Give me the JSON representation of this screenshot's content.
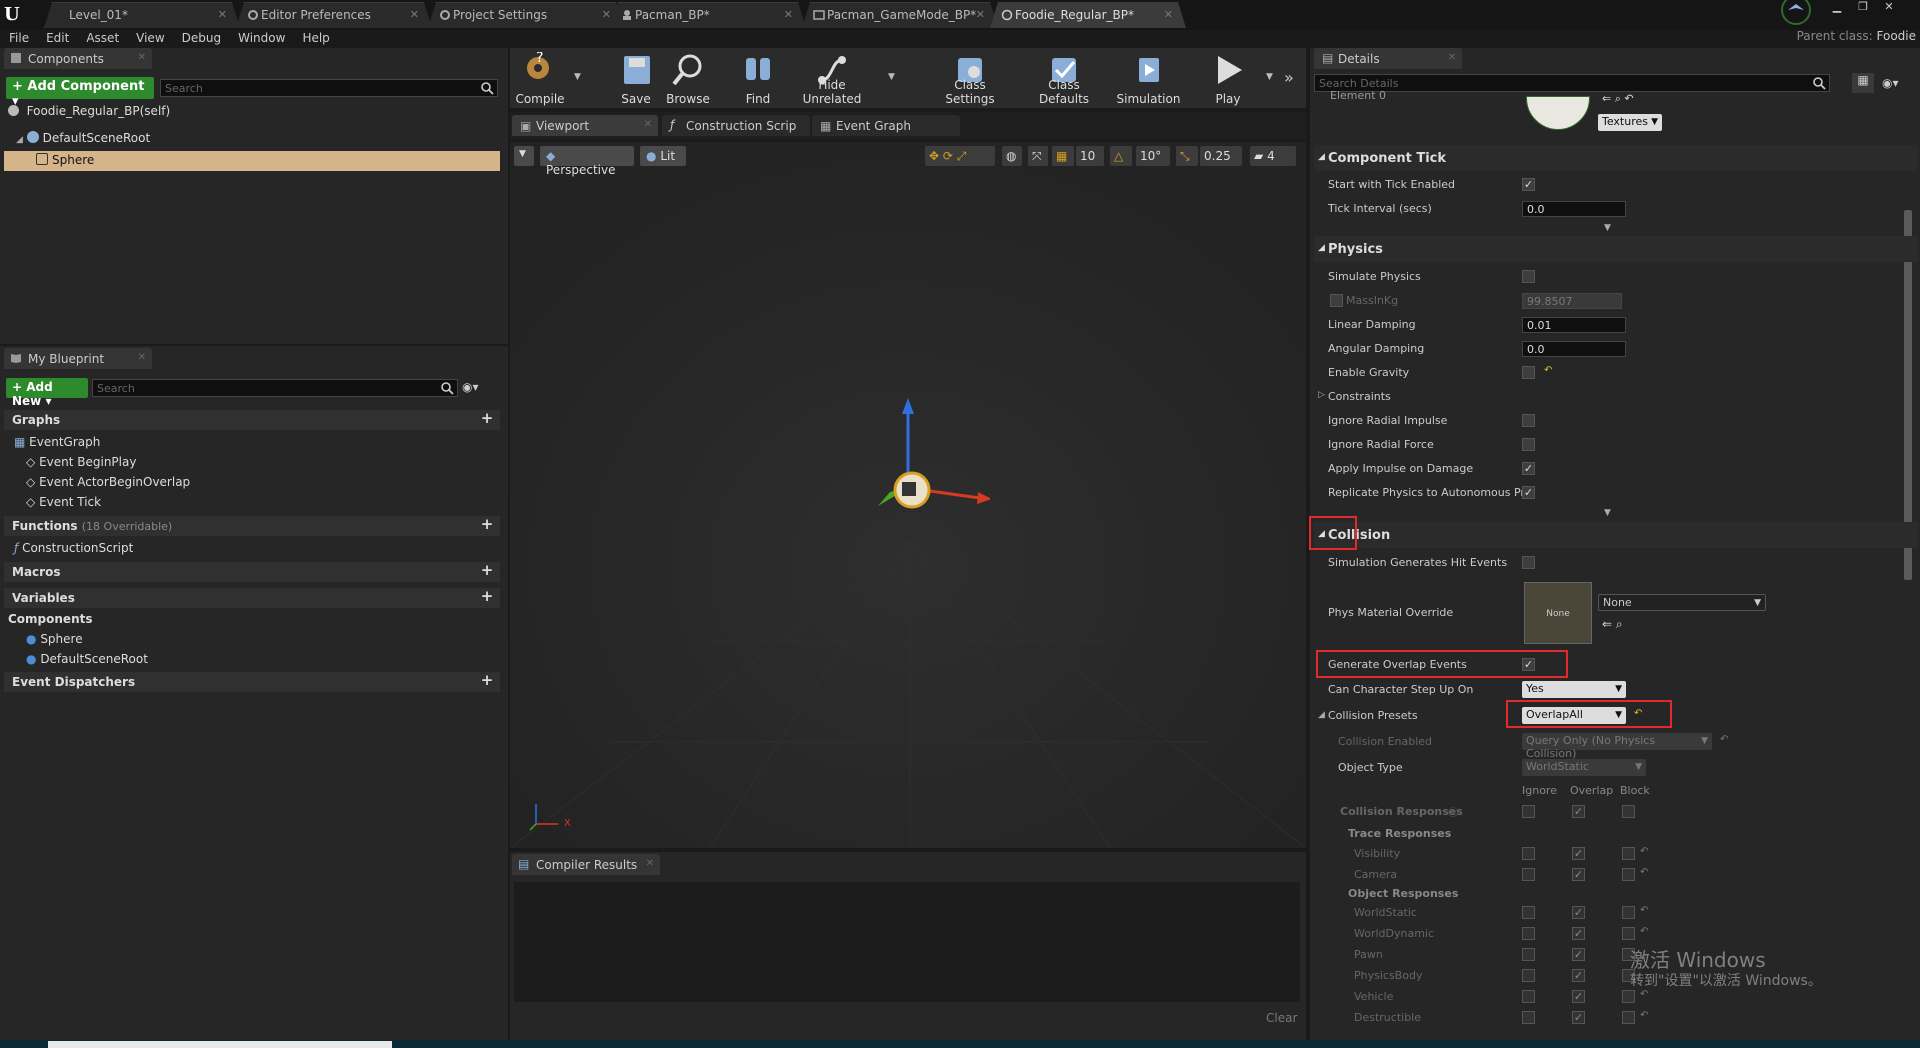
{
  "tabs": [
    {
      "label": "Level_01*",
      "active": false,
      "icon": "level-icon"
    },
    {
      "label": "Editor Preferences",
      "active": false,
      "icon": "gear-icon"
    },
    {
      "label": "Project Settings",
      "active": false,
      "icon": "gear-icon"
    },
    {
      "label": "Pacman_BP*",
      "active": false,
      "icon": "blueprint-icon"
    },
    {
      "label": "Pacman_GameMode_BP*",
      "active": false,
      "icon": "blueprint-icon"
    },
    {
      "label": "Foodie_Regular_BP*",
      "active": true,
      "icon": "blueprint-icon"
    }
  ],
  "parent_class": {
    "label": "Parent class:",
    "value": "Foodie"
  },
  "menu": [
    "File",
    "Edit",
    "Asset",
    "View",
    "Debug",
    "Window",
    "Help"
  ],
  "components_panel": {
    "tab": "Components",
    "add_component": "+ Add Component ▾",
    "search_placeholder": "Search",
    "self_item": "Foodie_Regular_BP(self)",
    "root": "DefaultSceneRoot",
    "selected": "Sphere"
  },
  "my_blueprint": {
    "tab": "My Blueprint",
    "add_new": "+ Add New ▾",
    "search_placeholder": "Search",
    "graphs_header": "Graphs",
    "event_graph": "EventGraph",
    "events": [
      "Event BeginPlay",
      "Event ActorBeginOverlap",
      "Event Tick"
    ],
    "functions_header": "Functions",
    "functions_count": "(18 Overridable)",
    "construction_script": "ConstructionScript",
    "macros_header": "Macros",
    "variables_header": "Variables",
    "components_header": "Components",
    "component_vars": [
      "Sphere",
      "DefaultSceneRoot"
    ],
    "dispatchers_header": "Event Dispatchers"
  },
  "toolbar": {
    "compile": "Compile",
    "save": "Save",
    "browse": "Browse",
    "find": "Find",
    "hide_unrelated": "Hide Unrelated",
    "class_settings": "Class Settings",
    "class_defaults": "Class Defaults",
    "simulation": "Simulation",
    "play": "Play"
  },
  "editor_tabs": [
    "Viewport",
    "Construction Scrip",
    "Event Graph"
  ],
  "viewport": {
    "perspective": "Perspective",
    "lit": "Lit",
    "grid_snap": "10",
    "rot_snap": "10°",
    "scale_snap": "0.25",
    "camera_speed": "4",
    "axis_x": "X"
  },
  "compiler": {
    "tab": "Compiler Results",
    "clear": "Clear"
  },
  "details": {
    "tab": "Details",
    "search_placeholder": "Search Details",
    "element_label": "Element 0",
    "textures_dropdown": "Textures",
    "component_tick": {
      "header": "Component Tick",
      "start_with_tick": "Start with Tick Enabled",
      "tick_interval_label": "Tick Interval (secs)",
      "tick_interval_value": "0.0"
    },
    "physics": {
      "header": "Physics",
      "simulate": "Simulate Physics",
      "mass_label": "MassInKg",
      "mass_value": "99.8507",
      "linear_damping_label": "Linear Damping",
      "linear_damping_value": "0.01",
      "angular_damping_label": "Angular Damping",
      "angular_damping_value": "0.0",
      "enable_gravity": "Enable Gravity",
      "constraints": "Constraints",
      "ignore_radial_impulse": "Ignore Radial Impulse",
      "ignore_radial_force": "Ignore Radial Force",
      "apply_impulse": "Apply Impulse on Damage",
      "replicate": "Replicate Physics to Autonomous Pro"
    },
    "collision": {
      "header": "Collision",
      "sim_hit_events": "Simulation Generates Hit Events",
      "phys_material": "Phys Material Override",
      "phys_material_thumb": "None",
      "phys_material_value": "None",
      "generate_overlap": "Generate Overlap Events",
      "can_step_up": "Can Character Step Up On",
      "can_step_up_value": "Yes",
      "presets": "Collision Presets",
      "presets_value": "OverlapAll",
      "collision_enabled": "Collision Enabled",
      "collision_enabled_value": "Query Only (No Physics Collision)",
      "object_type": "Object Type",
      "object_type_value": "WorldStatic",
      "col_ignore": "Ignore",
      "col_overlap": "Overlap",
      "col_block": "Block",
      "responses": "Collision Responses",
      "trace_responses": "Trace Responses",
      "trace_items": [
        "Visibility",
        "Camera"
      ],
      "object_responses": "Object Responses",
      "object_items": [
        "WorldStatic",
        "WorldDynamic",
        "Pawn",
        "PhysicsBody",
        "Vehicle",
        "Destructible"
      ]
    }
  },
  "watermark": {
    "line1": "激活 Windows",
    "line2": "转到\"设置\"以激活 Windows。"
  },
  "colors": {
    "accent_green": "#2d8a2d",
    "highlight_red": "#e32a2a",
    "selected_row": "#d6b48a"
  }
}
